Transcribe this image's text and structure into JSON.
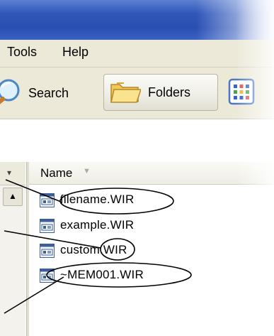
{
  "menu": {
    "tools": "Tools",
    "help": "Help"
  },
  "toolbar": {
    "search_label": "Search",
    "folders_label": "Folders",
    "search_icon": "search-icon",
    "folder_icon": "folder-icon",
    "views_icon": "views-icon"
  },
  "filelist": {
    "column_name": "Name",
    "files": [
      {
        "name": "filename.WIR",
        "icon": "wir-file-icon"
      },
      {
        "name": "example.WIR",
        "icon": "wir-file-icon"
      },
      {
        "name": "custom.WIR",
        "icon": "wir-file-icon"
      },
      {
        "name": "~MEM001.WIR",
        "icon": "wir-file-icon"
      }
    ]
  },
  "colors": {
    "titlebar": "#2a4fb3",
    "menubar": "#ece9d8",
    "annotation": "#000000"
  }
}
